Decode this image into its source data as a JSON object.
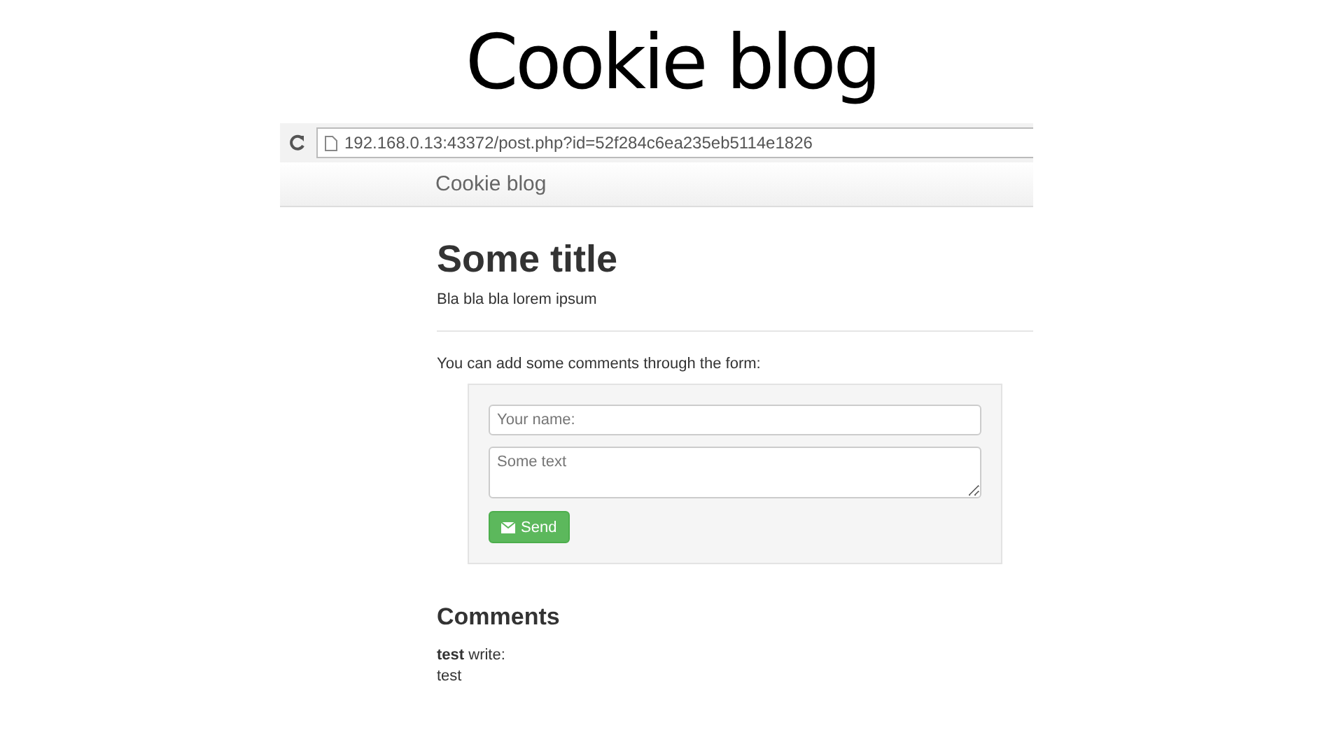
{
  "slide_title": "Cookie blog",
  "browser": {
    "url": "192.168.0.13:43372/post.php?id=52f284c6ea235eb5114e1826"
  },
  "navbar": {
    "brand": "Cookie blog"
  },
  "post": {
    "title": "Some title",
    "body": "Bla bla bla lorem ipsum"
  },
  "comment_form": {
    "intro": "You can add some comments through the form:",
    "name_placeholder": "Your name:",
    "text_placeholder": "Some text",
    "button": "Send"
  },
  "comments": {
    "heading": "Comments",
    "items": [
      {
        "header": "**test** write:",
        "text": "test"
      }
    ]
  }
}
